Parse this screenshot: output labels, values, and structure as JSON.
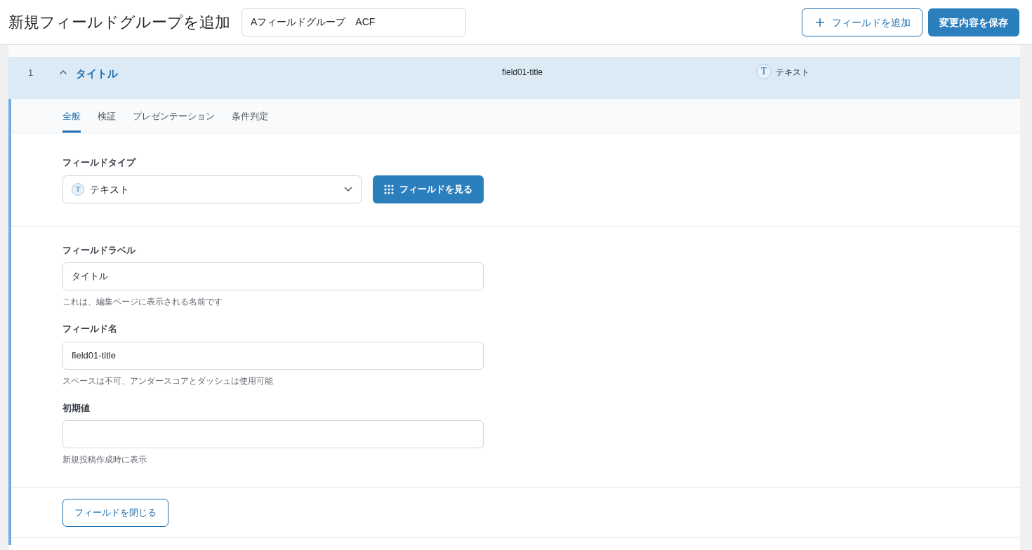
{
  "header": {
    "title": "新規フィールドグループを追加",
    "group_name_input": {
      "value": "Aフィールドグループ　ACF"
    },
    "buttons": [
      {
        "kind": "outline",
        "label": "フィールドを追加"
      },
      {
        "kind": "primary",
        "label": "変更内容を保存"
      }
    ]
  },
  "field_row": {
    "order": "1",
    "expanded": true,
    "label": "タイトル",
    "name": "field01-title",
    "type_icon": "T",
    "type": "テキスト"
  },
  "tabs": [
    {
      "label": "全般",
      "selected": true
    },
    {
      "label": "検証",
      "selected": false
    },
    {
      "label": "プレゼンテーション",
      "selected": false
    },
    {
      "label": "条件判定",
      "selected": false
    }
  ],
  "field_type": {
    "label": "フィールドタイプ",
    "icon": "T",
    "value": "テキスト",
    "browse_button": "フィールドを見る"
  },
  "settings": [
    {
      "label": "フィールドラベル",
      "value": "タイトル",
      "help": "これは、編集ページに表示される名前です"
    },
    {
      "label": "フィールド名",
      "value": "field01-title",
      "help": "スペースは不可、アンダースコアとダッシュは使用可能"
    },
    {
      "label": "初期値",
      "help": "新規投稿作成時に表示"
    }
  ],
  "close_button": "フィールドを閉じる"
}
